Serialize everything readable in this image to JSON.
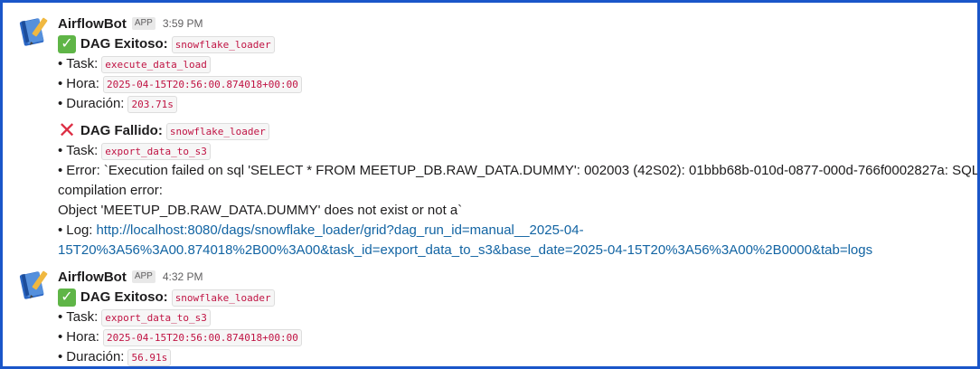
{
  "messages": [
    {
      "author": "AirflowBot",
      "badge": "APP",
      "time": "3:59 PM",
      "success": {
        "title": "DAG Exitoso:",
        "dag": "snowflake_loader",
        "task_label": "Task:",
        "task": "execute_data_load",
        "hora_label": "Hora:",
        "hora": "2025-04-15T20:56:00.874018+00:00",
        "duracion_label": "Duración:",
        "duracion": "203.71s"
      },
      "failure": {
        "title": "DAG Fallido:",
        "dag": "snowflake_loader",
        "task_label": "Task:",
        "task": "export_data_to_s3",
        "error_line1": "Error: `Execution failed on sql 'SELECT * FROM MEETUP_DB.RAW_DATA.DUMMY': 002003 (42S02): 01bbb68b-010d-0877-000d-766f0002827a: SQL",
        "error_line2": "compilation error:",
        "error_line3": "Object 'MEETUP_DB.RAW_DATA.DUMMY' does not exist or not a`",
        "log_label": "Log:",
        "log_url_line1": "http://localhost:8080/dags/snowflake_loader/grid?dag_run_id=manual__2025-04-",
        "log_url_line2": "15T20%3A56%3A00.874018%2B00%3A00&task_id=export_data_to_s3&base_date=2025-04-15T20%3A56%3A00%2B0000&tab=logs"
      }
    },
    {
      "author": "AirflowBot",
      "badge": "APP",
      "time": "4:32 PM",
      "success": {
        "title": "DAG Exitoso:",
        "dag": "snowflake_loader",
        "task_label": "Task:",
        "task": "export_data_to_s3",
        "hora_label": "Hora:",
        "hora": "2025-04-15T20:56:00.874018+00:00",
        "duracion_label": "Duración:",
        "duracion": "56.91s"
      }
    }
  ],
  "colors": {
    "frame": "#1a56c9",
    "code_text": "#c01343",
    "link": "#1264a3",
    "success_check": "#5fb547",
    "failure_cross": "#dd2e44"
  },
  "icons": {
    "avatar": "notebook-icon",
    "success": "check-mark-button-icon",
    "failure": "cross-mark-icon"
  }
}
